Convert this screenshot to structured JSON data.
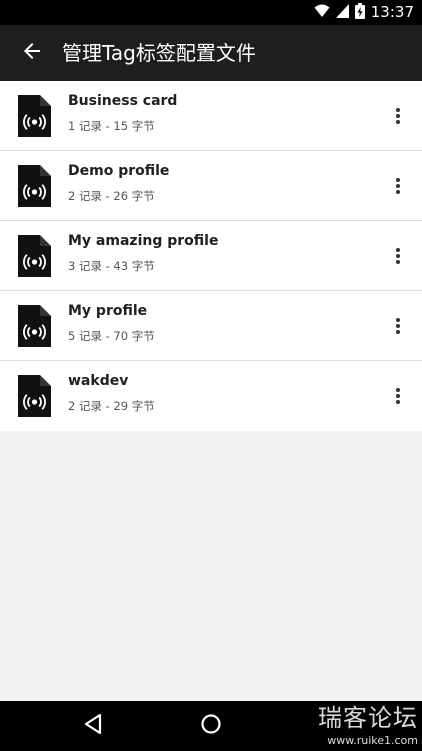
{
  "status_bar": {
    "time": "13:37",
    "icons": [
      "wifi-icon",
      "signal-icon",
      "battery-charging-icon"
    ]
  },
  "app_bar": {
    "back_icon": "arrow-back-icon",
    "title": "管理Tag标签配置文件"
  },
  "profiles": [
    {
      "name": "Business card",
      "details": "1 记录 - 15 字节",
      "icon": "nfc-file-icon",
      "menu_icon": "more-vert-icon"
    },
    {
      "name": "Demo profile",
      "details": "2 记录 - 26 字节",
      "icon": "nfc-file-icon",
      "menu_icon": "more-vert-icon"
    },
    {
      "name": "My amazing profile",
      "details": "3 记录 - 43 字节",
      "icon": "nfc-file-icon",
      "menu_icon": "more-vert-icon"
    },
    {
      "name": "My profile",
      "details": "5 记录 - 70 字节",
      "icon": "nfc-file-icon",
      "menu_icon": "more-vert-icon"
    },
    {
      "name": "wakdev",
      "details": "2 记录 - 29 字节",
      "icon": "nfc-file-icon",
      "menu_icon": "more-vert-icon"
    }
  ],
  "nav_bar": {
    "buttons": [
      "back-triangle-icon",
      "home-circle-icon"
    ]
  },
  "watermark": {
    "text": "瑞客论坛",
    "url": "www.ruike1.com"
  },
  "colors": {
    "app_bar": "#1e1e1e",
    "status_bar": "#000000",
    "list_bg": "#ffffff",
    "page_bg": "#f2f2f2",
    "divider": "#dcdcdc"
  }
}
